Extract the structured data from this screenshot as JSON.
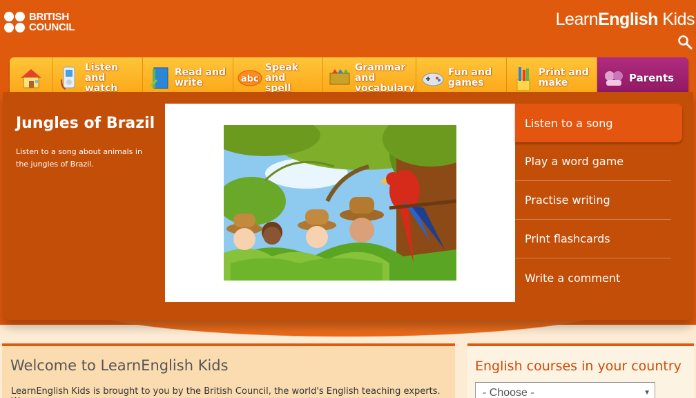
{
  "header": {
    "brand_line1": "BRITISH",
    "brand_line2": "COUNCIL",
    "site_title_light": "Learn",
    "site_title_bold": "English",
    "site_title_end": " Kids",
    "search_icon": "search-icon"
  },
  "nav": {
    "home_icon": "home-icon",
    "items": [
      {
        "label": "Listen and watch",
        "icon": "media-player-icon"
      },
      {
        "label": "Read and write",
        "icon": "book-icon"
      },
      {
        "label": "Speak and spell",
        "icon": "abc-icon"
      },
      {
        "label": "Grammar and vocabulary",
        "icon": "grammar-icon"
      },
      {
        "label": "Fun and games",
        "icon": "game-controller-icon"
      },
      {
        "label": "Print and make",
        "icon": "pencils-icon"
      },
      {
        "label": "Parents",
        "icon": "parents-icon"
      }
    ]
  },
  "feature": {
    "title": "Jungles of Brazil",
    "description": "Listen to a song about animals in the jungles of Brazil.",
    "image_name": "jungle-explorers-parrot"
  },
  "side_menu": [
    {
      "label": "Listen to a song",
      "active": true
    },
    {
      "label": "Play a word game",
      "active": false
    },
    {
      "label": "Practise writing",
      "active": false
    },
    {
      "label": "Print flashcards",
      "active": false
    },
    {
      "label": "Write a comment",
      "active": false
    }
  ],
  "welcome": {
    "heading": "Welcome to LearnEnglish Kids",
    "text": "LearnEnglish Kids is brought to you by the British Council, the world's English teaching experts. We"
  },
  "courses": {
    "heading": "English courses in your country",
    "select_value": "- Choose -"
  },
  "colors": {
    "brand_orange": "#e05a0e",
    "panel": "#c24e08",
    "nav_yellow": "#fba414",
    "parents_purple": "#9c1e6c"
  }
}
